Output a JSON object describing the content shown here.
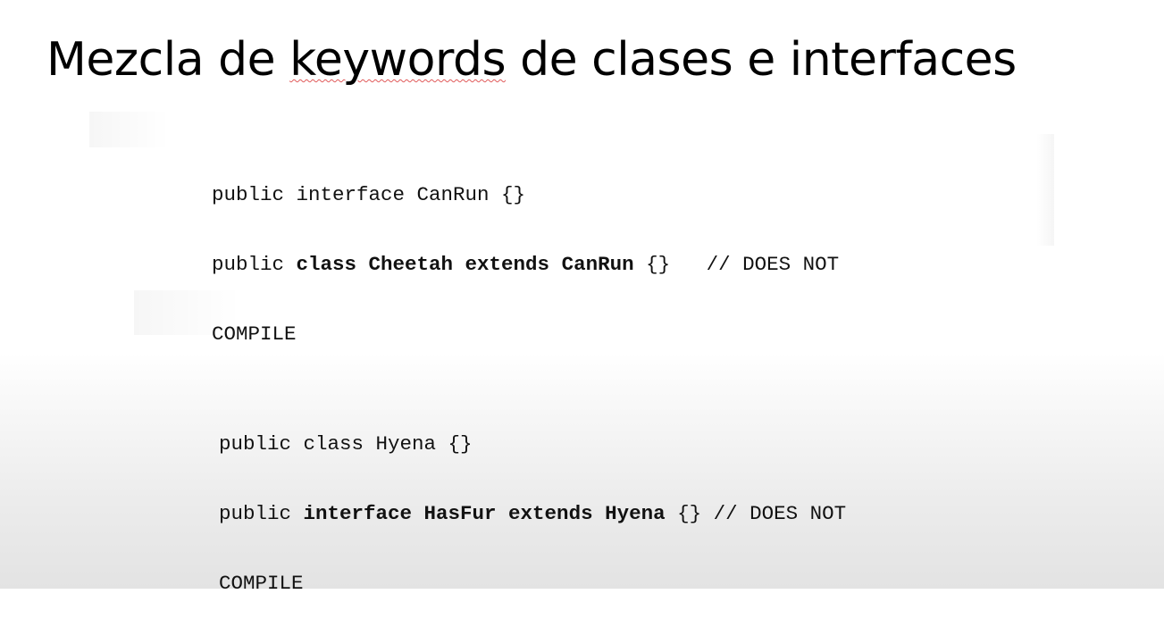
{
  "title": {
    "part1": "Mezcla de ",
    "keyword": "keywords",
    "part2": " de clases e interfaces"
  },
  "code_blocks": [
    {
      "lines": [
        {
          "pre": "public interface CanRun {}",
          "bold": "",
          "post": ""
        },
        {
          "pre": "public ",
          "bold": "class Cheetah extends CanRun",
          "post": " {}   // DOES NOT"
        },
        {
          "pre": "COMPILE",
          "bold": "",
          "post": ""
        }
      ]
    },
    {
      "lines": [
        {
          "pre": "public class Hyena {}",
          "bold": "",
          "post": ""
        },
        {
          "pre": "public ",
          "bold": "interface HasFur extends Hyena",
          "post": " {} // DOES NOT"
        },
        {
          "pre": "COMPILE",
          "bold": "",
          "post": ""
        }
      ]
    }
  ],
  "colors": {
    "text": "#000000",
    "spellcheck_underline": "#e05a5a"
  }
}
